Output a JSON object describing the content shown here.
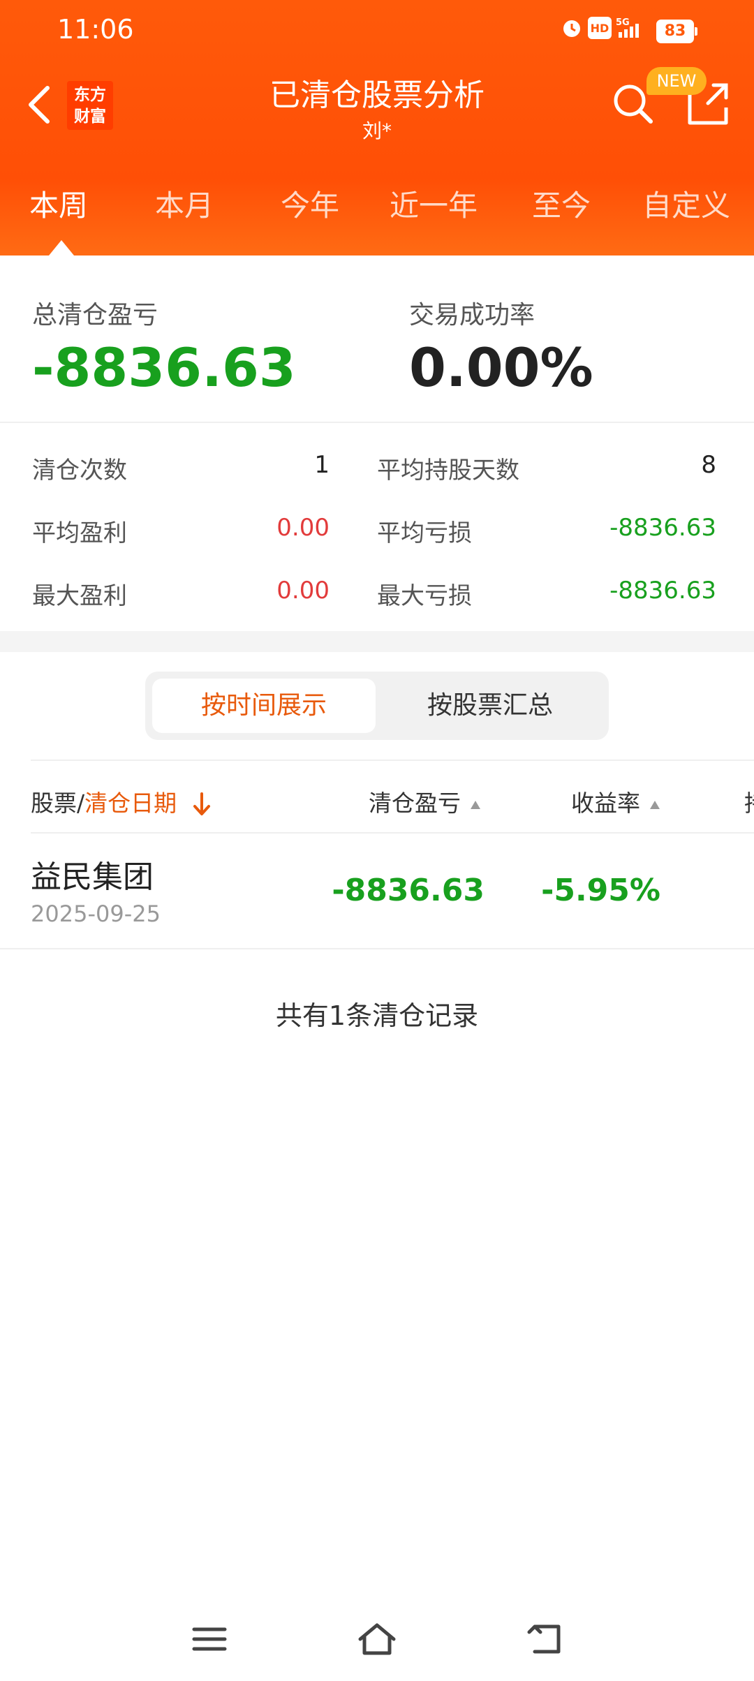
{
  "status_bar": {
    "time": "11:06",
    "battery": "83",
    "hd": "HD",
    "network": "5G"
  },
  "header": {
    "logo_line1": "东方",
    "logo_line2": "财富",
    "title": "已清仓股票分析",
    "subtitle": "刘*",
    "new_badge": "NEW"
  },
  "tabs": [
    {
      "label": "本周",
      "active": true
    },
    {
      "label": "本月"
    },
    {
      "label": "今年"
    },
    {
      "label": "近一年"
    },
    {
      "label": "至今"
    },
    {
      "label": "自定义"
    }
  ],
  "summary": {
    "total_label": "总清仓盈亏",
    "total_value": "-8836.63",
    "rate_label": "交易成功率",
    "rate_value": "0.00%"
  },
  "stats": {
    "count_label": "清仓次数",
    "count_value": "1",
    "avg_days_label": "平均持股天数",
    "avg_days_value": "8",
    "avg_profit_label": "平均盈利",
    "avg_profit_value": "0.00",
    "avg_loss_label": "平均亏损",
    "avg_loss_value": "-8836.63",
    "max_profit_label": "最大盈利",
    "max_profit_value": "0.00",
    "max_loss_label": "最大亏损",
    "max_loss_value": "-8836.63"
  },
  "segment": {
    "by_time": "按时间展示",
    "by_stock": "按股票汇总"
  },
  "table": {
    "col_stock": "股票/",
    "col_date": "清仓日期",
    "col_pnl": "清仓盈亏",
    "col_return": "收益率",
    "col_more": "持",
    "rows": [
      {
        "name": "益民集团",
        "date": "2025-09-25",
        "pnl": "-8836.63",
        "return": "-5.95%"
      }
    ]
  },
  "footer_note": "共有1条清仓记录",
  "colors": {
    "header": "#ff5a0a",
    "loss": "#18a01e",
    "profit": "#e23b3b",
    "accent": "#e85a0c"
  }
}
